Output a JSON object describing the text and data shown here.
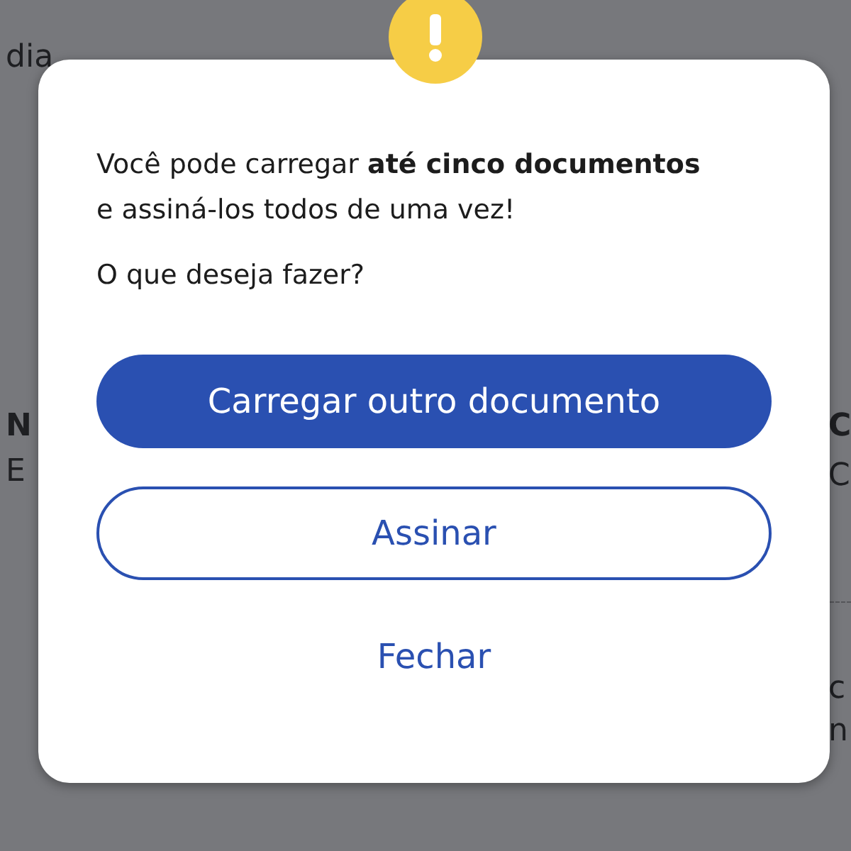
{
  "left_fragments": [
    {
      "text": "dia",
      "kind": "plain"
    },
    {
      "text": "N",
      "kind": "bold"
    },
    {
      "text": "E",
      "kind": "plain"
    }
  ],
  "right_fragments": [
    {
      "text": "C",
      "kind": "bold"
    },
    {
      "text": "C",
      "kind": "plain"
    },
    {
      "text": "c",
      "kind": "plain"
    },
    {
      "text": "n",
      "kind": "plain"
    }
  ],
  "dialog": {
    "message": "Você pode carregar **até cinco documentos** e assiná-los todos de uma vez!",
    "question": "O que deseja fazer?",
    "buttons": [
      {
        "label": "Carregar outro documento",
        "kind": "primary"
      },
      {
        "label": "Assinar",
        "kind": "outline"
      },
      {
        "label": "Fechar",
        "kind": "link"
      }
    ]
  }
}
